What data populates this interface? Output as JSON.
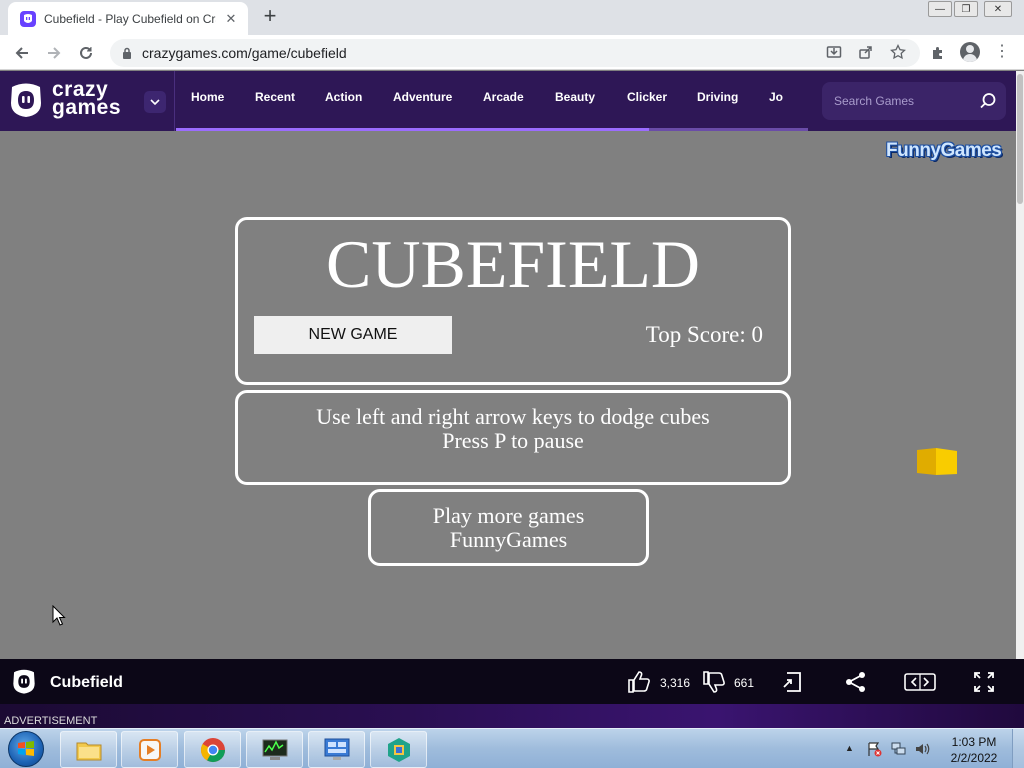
{
  "browser": {
    "tab_title": "Cubefield - Play Cubefield on Cra",
    "new_tab": "+",
    "url": "crazygames.com/game/cubefield"
  },
  "site": {
    "logo_text_line1": "crazy",
    "logo_text_line2": "games",
    "nav": [
      "Home",
      "Recent",
      "Action",
      "Adventure",
      "Arcade",
      "Beauty",
      "Clicker",
      "Driving",
      "Jo"
    ],
    "search_placeholder": "Search Games",
    "brand_color": "#2e1756"
  },
  "game": {
    "partner_logo": "FunnyGames",
    "title": "CUBEFIELD",
    "new_game_label": "NEW GAME",
    "top_score_label": "Top Score: 0",
    "instructions_line1": "Use left and right arrow keys to dodge cubes",
    "instructions_line2": "Press P to pause",
    "more_line1": "Play more games",
    "more_line2": "FunnyGames",
    "background_color": "#808080",
    "cube_color": "#f5c400"
  },
  "gamebar": {
    "title": "Cubefield",
    "likes": "3,316",
    "dislikes": "661"
  },
  "ad": {
    "label": "ADVERTISEMENT"
  },
  "taskbar": {
    "time": "1:03 PM",
    "date": "2/2/2022",
    "apps": [
      "file-explorer-icon",
      "media-player-icon",
      "chrome-icon",
      "task-manager-icon",
      "remote-desktop-icon",
      "package-icon"
    ]
  }
}
